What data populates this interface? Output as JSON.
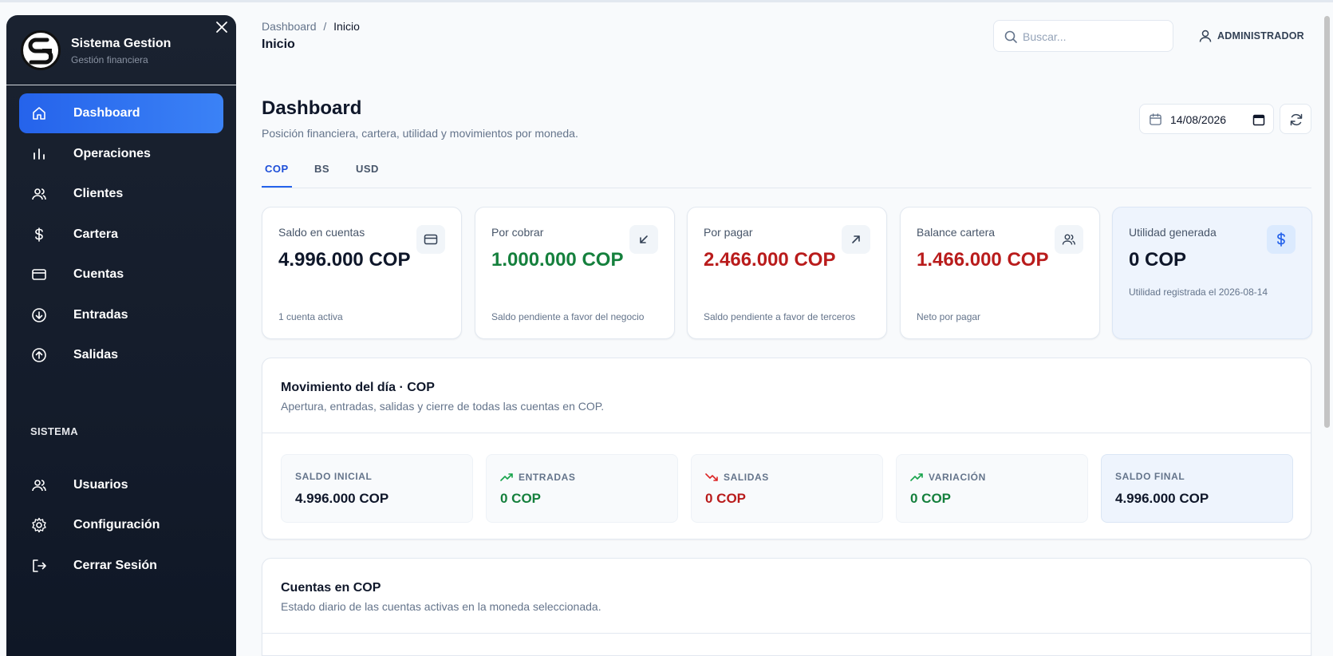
{
  "brand": {
    "title": "Sistema Gestion",
    "subtitle": "Gestión financiera",
    "logo_text": "SG"
  },
  "sidebar": {
    "items": [
      {
        "label": "Dashboard",
        "icon": "home-icon",
        "active": true
      },
      {
        "label": "Operaciones",
        "icon": "bar-chart-icon"
      },
      {
        "label": "Clientes",
        "icon": "users-icon"
      },
      {
        "label": "Cartera",
        "icon": "dollar-icon"
      },
      {
        "label": "Cuentas",
        "icon": "credit-card-icon"
      },
      {
        "label": "Entradas",
        "icon": "arrow-down-circle-icon"
      },
      {
        "label": "Salidas",
        "icon": "arrow-up-circle-icon"
      }
    ],
    "system_section": "SISTEMA",
    "system_items": [
      {
        "label": "Usuarios",
        "icon": "users-icon"
      },
      {
        "label": "Configuración",
        "icon": "gear-icon"
      },
      {
        "label": "Cerrar Sesión",
        "icon": "logout-icon"
      }
    ]
  },
  "header": {
    "breadcrumb": {
      "root": "Dashboard",
      "separator": "/",
      "current": "Inicio"
    },
    "title": "Inicio",
    "search_placeholder": "Buscar...",
    "user_label": "ADMINISTRADOR"
  },
  "page": {
    "title": "Dashboard",
    "subtitle": "Posición financiera, cartera, utilidad y movimientos por moneda.",
    "date": "14/08/2026"
  },
  "tabs": [
    {
      "label": "COP",
      "active": true
    },
    {
      "label": "BS"
    },
    {
      "label": "USD"
    }
  ],
  "cards": [
    {
      "title": "Saldo en cuentas",
      "value": "4.996.000 COP",
      "note": "1 cuenta activa",
      "icon": "credit-card-icon",
      "tone": "default"
    },
    {
      "title": "Por cobrar",
      "value": "1.000.000 COP",
      "note": "Saldo pendiente a favor del negocio",
      "icon": "arrow-down-left-icon",
      "tone": "green"
    },
    {
      "title": "Por pagar",
      "value": "2.466.000 COP",
      "note": "Saldo pendiente a favor de terceros",
      "icon": "arrow-up-right-icon",
      "tone": "red"
    },
    {
      "title": "Balance cartera",
      "value": "1.466.000 COP",
      "note": "Neto por pagar",
      "icon": "users-icon",
      "tone": "red"
    },
    {
      "title": "Utilidad generada",
      "value": "0 COP",
      "note": "Utilidad registrada el 2026-08-14",
      "icon": "dollar-icon",
      "tone": "default"
    }
  ],
  "movement": {
    "title": "Movimiento del día · COP",
    "subtitle": "Apertura, entradas, salidas y cierre de todas las cuentas en COP.",
    "items": [
      {
        "label": "SALDO INICIAL",
        "value": "4.996.000 COP",
        "tone": "default"
      },
      {
        "label": "ENTRADAS",
        "value": "0 COP",
        "tone": "green",
        "icon": "trending-up-icon"
      },
      {
        "label": "SALIDAS",
        "value": "0 COP",
        "tone": "red",
        "icon": "trending-down-icon"
      },
      {
        "label": "VARIACIÓN",
        "value": "0 COP",
        "tone": "green",
        "icon": "trending-up-icon"
      },
      {
        "label": "SALDO FINAL",
        "value": "4.996.000 COP",
        "tone": "default"
      }
    ]
  },
  "accounts": {
    "title": "Cuentas en COP",
    "subtitle": "Estado diario de las cuentas activas en la moneda seleccionada."
  },
  "colors": {
    "sidebar_bg": "#141c2b",
    "accent": "#2563eb",
    "positive": "#15803d",
    "negative": "#b91c1c"
  }
}
